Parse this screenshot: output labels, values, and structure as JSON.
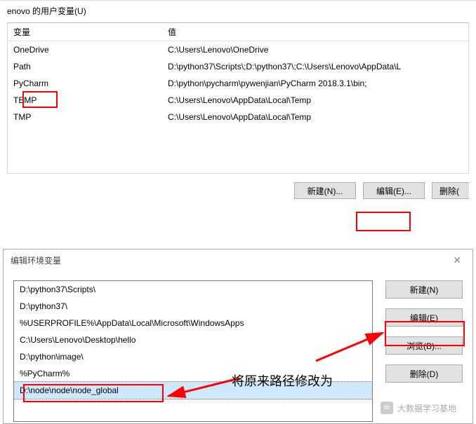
{
  "section": {
    "title": "enovo 的用户变量(U)"
  },
  "table": {
    "headers": {
      "var": "变量",
      "val": "值"
    },
    "rows": [
      {
        "var": "OneDrive",
        "val": "C:\\Users\\Lenovo\\OneDrive"
      },
      {
        "var": "Path",
        "val": "D:\\python37\\Scripts\\;D:\\python37\\;C:\\Users\\Lenovo\\AppData\\L"
      },
      {
        "var": "PyCharm",
        "val": "D:\\python\\pycharm\\pywenjian\\PyCharm 2018.3.1\\bin;"
      },
      {
        "var": "TEMP",
        "val": "C:\\Users\\Lenovo\\AppData\\Local\\Temp"
      },
      {
        "var": "TMP",
        "val": "C:\\Users\\Lenovo\\AppData\\Local\\Temp"
      }
    ]
  },
  "buttons_main": {
    "new": "新建(N)...",
    "edit": "编辑(E)...",
    "delete": "删除("
  },
  "dialog": {
    "title": "编辑环境变量",
    "items": [
      "D:\\python37\\Scripts\\",
      "D:\\python37\\",
      "%USERPROFILE%\\AppData\\Local\\Microsoft\\WindowsApps",
      "C:\\Users\\Lenovo\\Desktop\\hello",
      "D:\\python\\image\\",
      "%PyCharm%",
      "D:\\node\\node\\node_global"
    ],
    "selected_index": 6,
    "side_buttons": {
      "new": "新建(N)",
      "edit": "编辑(E)",
      "browse": "浏览(B)...",
      "delete": "删除(D)"
    }
  },
  "annotation": {
    "text": "将原来路径修改为"
  },
  "watermark": {
    "text": "大数据学习基地"
  }
}
